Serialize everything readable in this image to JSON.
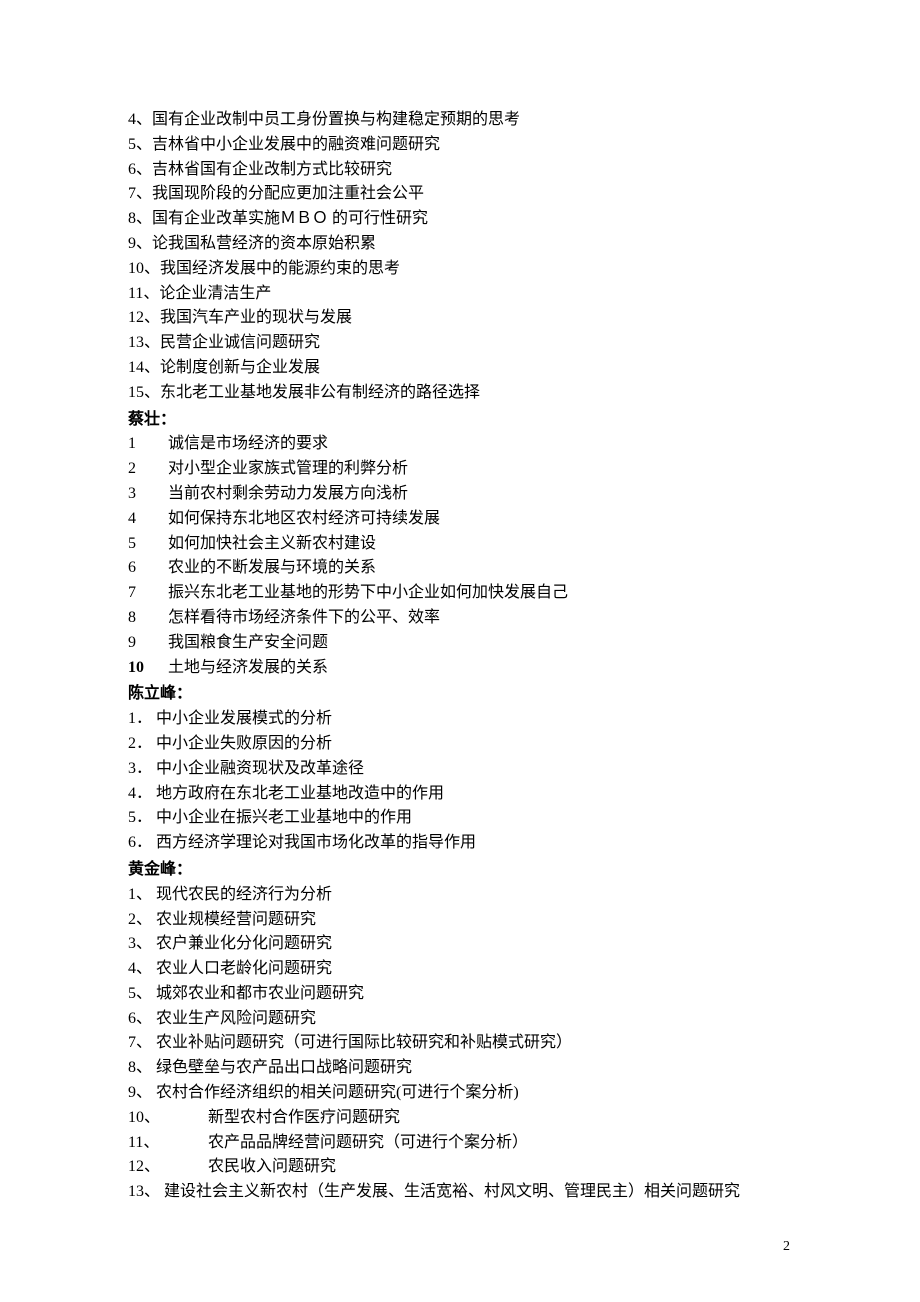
{
  "section1": {
    "items": [
      {
        "num": "4、",
        "text": "国有企业改制中员工身份置换与构建稳定预期的思考"
      },
      {
        "num": "5、",
        "text": "吉林省中小企业发展中的融资难问题研究"
      },
      {
        "num": "6、",
        "text": "吉林省国有企业改制方式比较研究"
      },
      {
        "num": "7、",
        "text": "我国现阶段的分配应更加注重社会公平"
      },
      {
        "num": "8、",
        "text": "国有企业改革实施ＭＢＯ 的可行性研究"
      },
      {
        "num": "9、",
        "text": "论我国私营经济的资本原始积累"
      },
      {
        "num": "10、",
        "text": "我国经济发展中的能源约束的思考"
      },
      {
        "num": "11、",
        "text": "论企业清洁生产"
      },
      {
        "num": "12、",
        "text": "我国汽车产业的现状与发展"
      },
      {
        "num": "13、",
        "text": "民营企业诚信问题研究"
      },
      {
        "num": "14、",
        "text": "论制度创新与企业发展"
      },
      {
        "num": "15、",
        "text": "东北老工业基地发展非公有制经济的路径选择"
      }
    ]
  },
  "section2": {
    "author": "蔡壮：",
    "items": [
      {
        "num": "1",
        "text": "诚信是市场经济的要求"
      },
      {
        "num": "2",
        "text": "对小型企业家族式管理的利弊分析"
      },
      {
        "num": "3",
        "text": "当前农村剩余劳动力发展方向浅析"
      },
      {
        "num": "4",
        "text": "如何保持东北地区农村经济可持续发展"
      },
      {
        "num": "5",
        "text": "如何加快社会主义新农村建设"
      },
      {
        "num": "6",
        "text": "农业的不断发展与环境的关系"
      },
      {
        "num": "7",
        "text": "振兴东北老工业基地的形势下中小企业如何加快发展自己"
      },
      {
        "num": "8",
        "text": "怎样看待市场经济条件下的公平、效率"
      },
      {
        "num": "9",
        "text": "我国粮食生产安全问题"
      },
      {
        "num": "10",
        "text": "土地与经济发展的关系",
        "boldnum": true
      }
    ]
  },
  "section3": {
    "author": "陈立峰：",
    "items": [
      {
        "num": "1．",
        "text": "中小企业发展模式的分析"
      },
      {
        "num": "2．",
        "text": "中小企业失败原因的分析"
      },
      {
        "num": "3．",
        "text": "中小企业融资现状及改革途径"
      },
      {
        "num": "4．",
        "text": "地方政府在东北老工业基地改造中的作用"
      },
      {
        "num": "5．",
        "text": "中小企业在振兴老工业基地中的作用"
      },
      {
        "num": "6．",
        "text": "西方经济学理论对我国市场化改革的指导作用"
      }
    ]
  },
  "section4": {
    "author": "黄金峰：",
    "items": [
      {
        "num": "1、",
        "text": "现代农民的经济行为分析"
      },
      {
        "num": "2、",
        "text": "农业规模经营问题研究"
      },
      {
        "num": "3、",
        "text": "农户兼业化分化问题研究"
      },
      {
        "num": "4、",
        "text": "农业人口老龄化问题研究"
      },
      {
        "num": "5、",
        "text": "城郊农业和都市农业问题研究"
      },
      {
        "num": "6、",
        "text": "农业生产风险问题研究"
      },
      {
        "num": "7、",
        "text": "农业补贴问题研究（可进行国际比较研究和补贴模式研究）"
      },
      {
        "num": "8、",
        "text": "绿色壁垒与农产品出口战略问题研究"
      },
      {
        "num": "9、",
        "text": "农村合作经济组织的相关问题研究(可进行个案分析)"
      },
      {
        "num": "10、",
        "text": "新型农村合作医疗问题研究",
        "wide": true
      },
      {
        "num": "11、",
        "text": "农产品品牌经营问题研究（可进行个案分析）",
        "wide": true
      },
      {
        "num": "12、",
        "text": "农民收入问题研究",
        "wide": true
      },
      {
        "num": "13、",
        "text": "建设社会主义新农村（生产发展、生活宽裕、村风文明、管理民主）相关问题研究"
      }
    ]
  },
  "page_number": "2"
}
